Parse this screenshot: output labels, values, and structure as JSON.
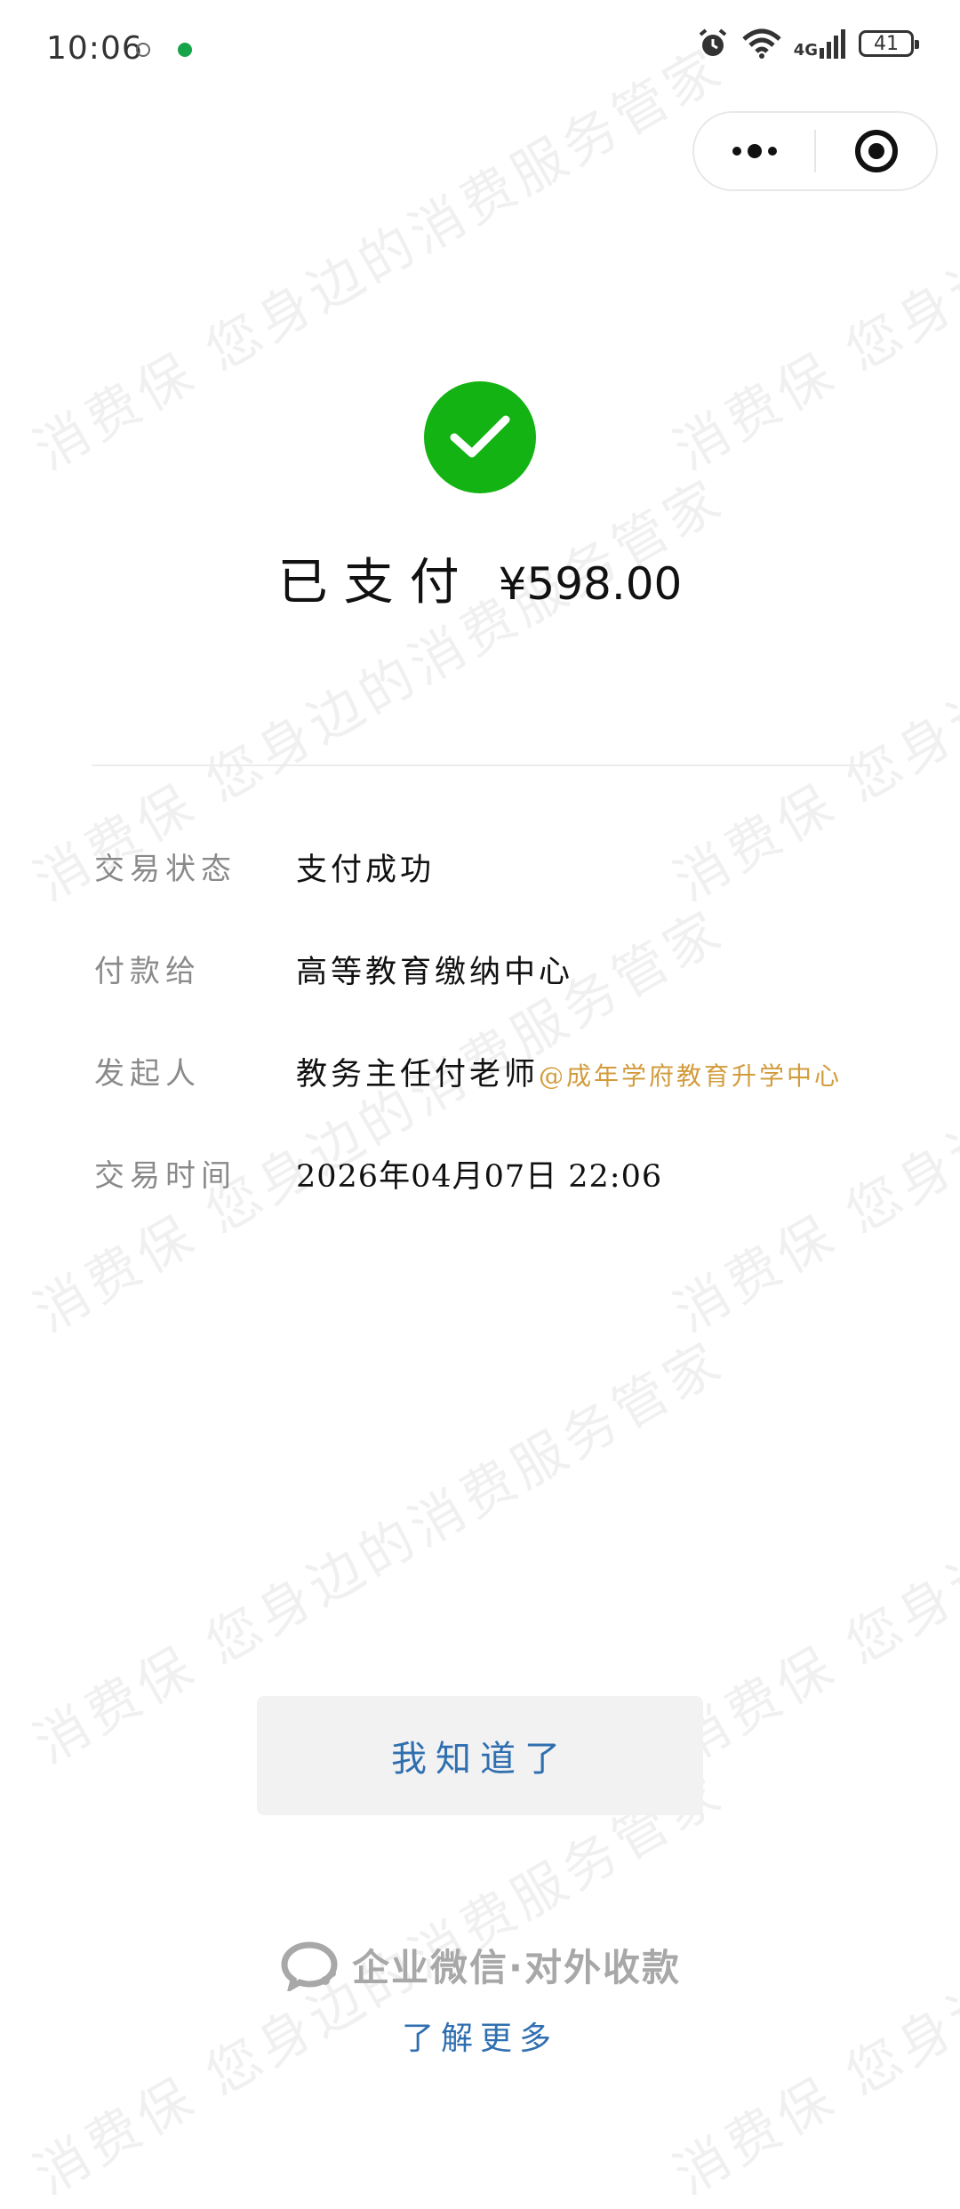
{
  "status_bar": {
    "time": "10:06",
    "network": "4G",
    "battery": "41"
  },
  "capsule": {
    "more_icon": "more-dots-icon",
    "close_icon": "target-close-icon"
  },
  "watermark_text": "消费保 您身边的消费服务管家",
  "payment": {
    "status_title": "已支付",
    "amount": "¥598.00",
    "success_color": "#13b313"
  },
  "details": [
    {
      "label": "交易状态",
      "value": "支付成功"
    },
    {
      "label": "付款给",
      "value": "高等教育缴纳中心"
    },
    {
      "label": "发起人",
      "value": "教务主任付老师",
      "org": "@成年学府教育升学中心"
    },
    {
      "label": "交易时间",
      "value": "2026年04月07日  22:06"
    }
  ],
  "buttons": {
    "ok_label": "我知道了"
  },
  "footer": {
    "brand": "企业微信·对外收款",
    "learn_more": "了解更多"
  },
  "colors": {
    "link_blue": "#2f6fb0",
    "org_orange": "#d29c3c"
  }
}
